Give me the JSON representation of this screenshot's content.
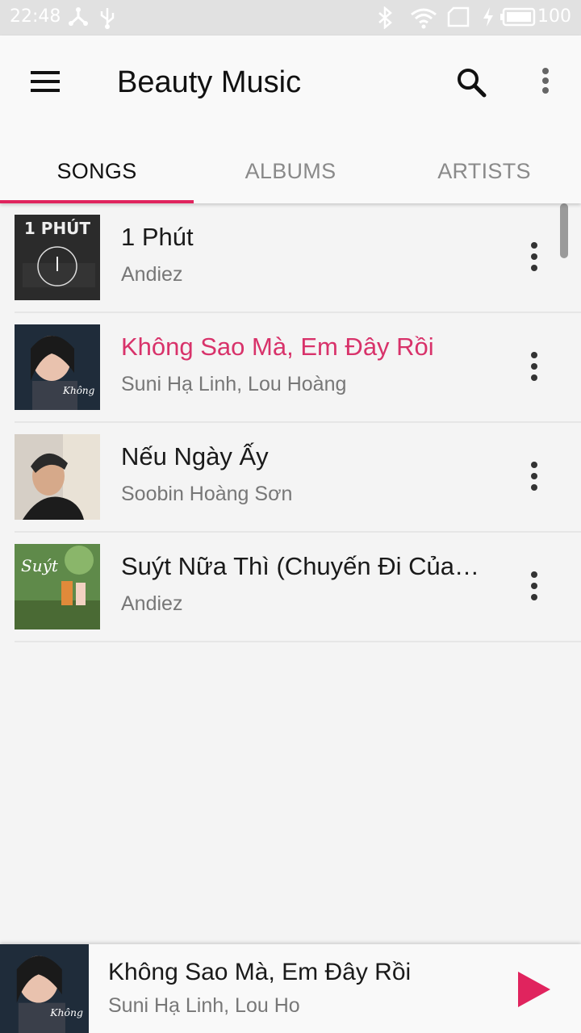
{
  "status_bar": {
    "time": "22:48",
    "battery": "100",
    "icons": [
      "share-icon",
      "usb-icon",
      "bluetooth-icon",
      "wifi-icon",
      "sim-icon",
      "charging-icon",
      "battery-icon"
    ]
  },
  "app_bar": {
    "title": "Beauty Music",
    "menu_icon": "hamburger-menu-icon",
    "search_icon": "search-icon",
    "overflow_icon": "more-vertical-icon"
  },
  "tabs": [
    {
      "label": "SONGS",
      "active": true
    },
    {
      "label": "ALBUMS",
      "active": false
    },
    {
      "label": "ARTISTS",
      "active": false
    }
  ],
  "colors": {
    "accent": "#e0245e",
    "playing_title": "#d8326a",
    "status_bar": "#e1e1e1"
  },
  "songs": [
    {
      "title": "1 Phút",
      "artist": "Andiez",
      "playing": false
    },
    {
      "title": "Không Sao Mà, Em Đây Rồi",
      "artist": "Suni Hạ Linh, Lou Hoàng",
      "playing": true
    },
    {
      "title": "Nếu Ngày Ấy",
      "artist": "Soobin Hoàng Sơn",
      "playing": false
    },
    {
      "title": "Suýt Nữa Thì (Chuyến Đi Của …",
      "artist": "Andiez",
      "playing": false
    }
  ],
  "now_playing": {
    "title": "Không Sao Mà, Em Đây Rồi",
    "artist": "Suni Hạ Linh, Lou Ho",
    "play_icon": "play-icon"
  }
}
